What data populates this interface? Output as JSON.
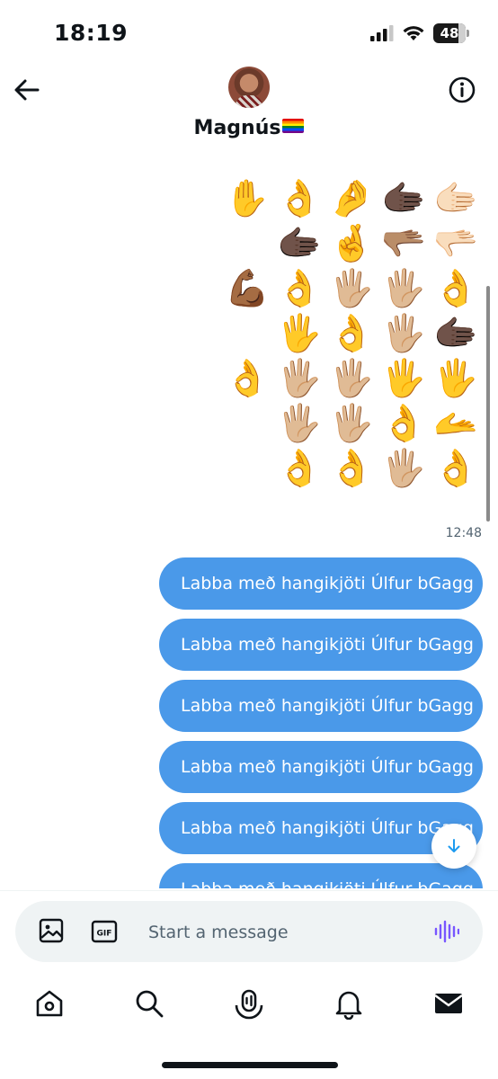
{
  "status_bar": {
    "time": "18:19",
    "battery": "48"
  },
  "header": {
    "contact_name": "Magnús",
    "flag_emoji": "rainbow-flag"
  },
  "emoji_message": {
    "rows": [
      [
        "✋",
        "👌",
        "🤌",
        "🫱🏿",
        "🫱🏻"
      ],
      [
        "🫱🏿",
        "🤞",
        "🫳🏽",
        "🫳🏻"
      ],
      [
        "💪🏾",
        "👌",
        "🖐🏼",
        "🖐🏼",
        "👌"
      ],
      [
        "🖐",
        "👌",
        "🖐🏼",
        "🫱🏿"
      ],
      [
        "👌",
        "🖐🏼",
        "🖐🏼",
        "🖐",
        "🖐"
      ],
      [
        "🖐🏼",
        "🖐🏼",
        "👌",
        "🫴"
      ],
      [
        "👌",
        "👌",
        "🖐🏼",
        "👌"
      ]
    ],
    "timestamp": "12:48"
  },
  "messages": [
    "Labba með hangikjöti Úlfur bGagg",
    "Labba með hangikjöti Úlfur bGagg",
    "Labba með hangikjöti Úlfur bGagg",
    "Labba með hangikjöti Úlfur bGagg",
    "Labba með hangikjöti Úlfur bGagg",
    "Labba með hangikjöti Úlfur bGagg"
  ],
  "composer": {
    "placeholder": "Start a message",
    "gif_label": "GIF"
  },
  "colors": {
    "bubble": "#4a99e9",
    "accent_voice": "#7856ff",
    "text_secondary": "#536471"
  },
  "nav": [
    "home-icon",
    "search-icon",
    "spaces-icon",
    "notifications-icon",
    "messages-icon"
  ]
}
